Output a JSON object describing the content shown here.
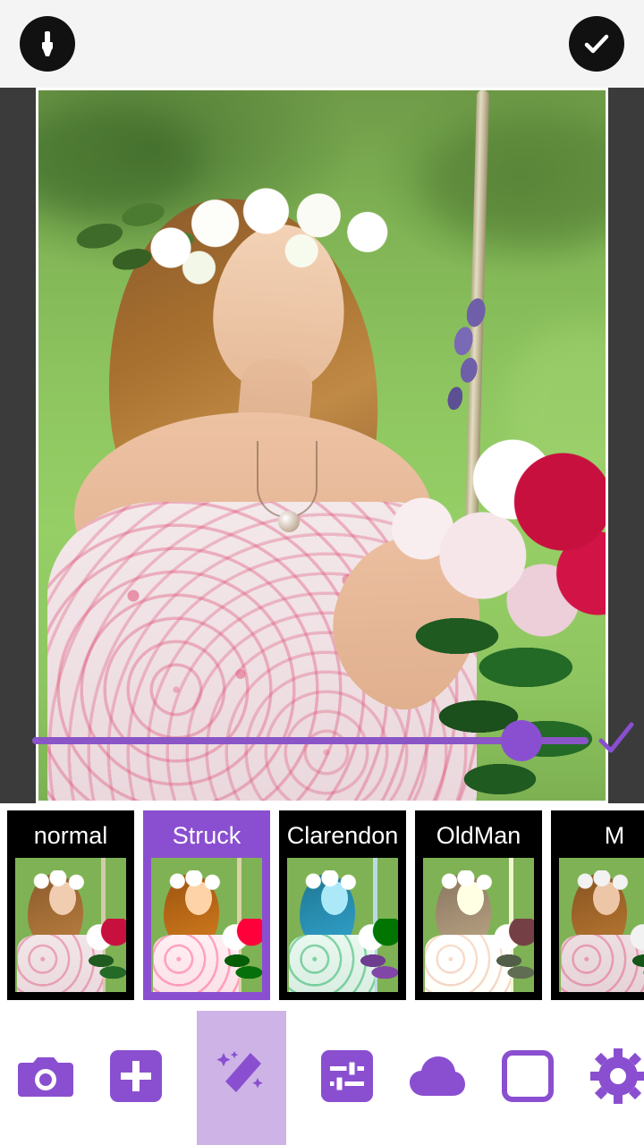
{
  "topbar": {
    "brush_button": "brush-icon",
    "confirm_button": "check-icon"
  },
  "editor": {
    "slider": {
      "value_percent": 88,
      "apply_icon": "check-icon"
    }
  },
  "filters": {
    "selected": "Struck",
    "items": [
      {
        "label": "normal",
        "variant": "none"
      },
      {
        "label": "Struck",
        "variant": "struck"
      },
      {
        "label": "Clarendon",
        "variant": "clarendon"
      },
      {
        "label": "OldMan",
        "variant": "oldman"
      },
      {
        "label": "M",
        "variant": "m"
      }
    ]
  },
  "toolbar": {
    "items": [
      {
        "name": "camera-icon",
        "label": "Camera"
      },
      {
        "name": "add-icon",
        "label": "Add"
      },
      {
        "name": "magic-wand-icon",
        "label": "Effects"
      },
      {
        "name": "adjust-sliders-icon",
        "label": "Adjust"
      },
      {
        "name": "cloud-icon",
        "label": "Overlay"
      },
      {
        "name": "square-frame-icon",
        "label": "Frame"
      },
      {
        "name": "gear-icon",
        "label": "Settings"
      }
    ],
    "active": "magic-wand-icon"
  },
  "colors": {
    "accent_purple": "#8a4fd0",
    "active_cell": "#cdb3e6",
    "topbar_bg": "#f4f4f4",
    "canvas_bg": "#3b3b3b",
    "filter_tile": "#000000"
  }
}
